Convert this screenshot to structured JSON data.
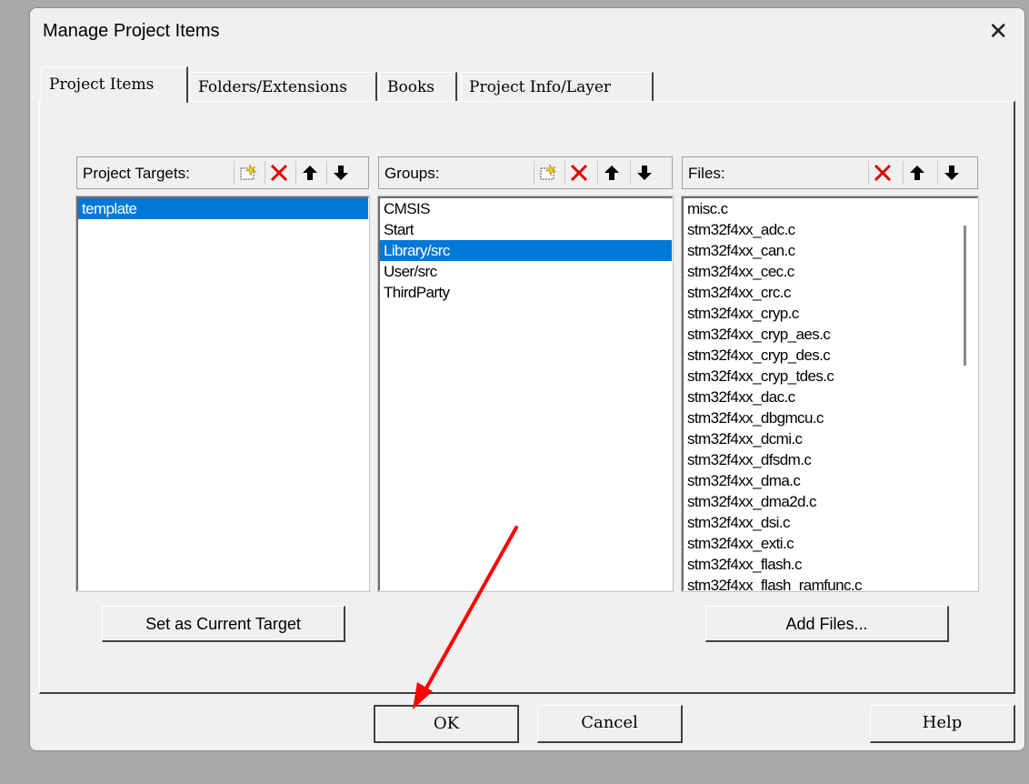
{
  "window": {
    "title": "Manage Project Items",
    "close_glyph": "✕"
  },
  "tabs": [
    {
      "label": "Project Items"
    },
    {
      "label": "Folders/Extensions"
    },
    {
      "label": "Books"
    },
    {
      "label": "Project Info/Layer"
    }
  ],
  "targets": {
    "label": "Project Targets:",
    "items": [
      "template"
    ],
    "selected": "template",
    "button": "Set as Current Target"
  },
  "groups": {
    "label": "Groups:",
    "items": [
      "CMSIS",
      "Start",
      "Library/src",
      "User/src",
      "ThirdParty"
    ],
    "selected": "Library/src"
  },
  "files": {
    "label": "Files:",
    "items": [
      "misc.c",
      "stm32f4xx_adc.c",
      "stm32f4xx_can.c",
      "stm32f4xx_cec.c",
      "stm32f4xx_crc.c",
      "stm32f4xx_cryp.c",
      "stm32f4xx_cryp_aes.c",
      "stm32f4xx_cryp_des.c",
      "stm32f4xx_cryp_tdes.c",
      "stm32f4xx_dac.c",
      "stm32f4xx_dbgmcu.c",
      "stm32f4xx_dcmi.c",
      "stm32f4xx_dfsdm.c",
      "stm32f4xx_dma.c",
      "stm32f4xx_dma2d.c",
      "stm32f4xx_dsi.c",
      "stm32f4xx_exti.c",
      "stm32f4xx_flash.c",
      "stm32f4xx_flash_ramfunc.c"
    ],
    "button": "Add Files..."
  },
  "buttons": {
    "ok": "OK",
    "cancel": "Cancel",
    "help": "Help"
  },
  "icons": {
    "new": "new-item-icon",
    "delete": "delete-x-icon",
    "up": "move-up-arrow-icon",
    "down": "move-down-arrow-icon"
  },
  "colors": {
    "selection": "#0078d7",
    "delete_red": "#e00000",
    "annotation_arrow": "#ff0000"
  }
}
